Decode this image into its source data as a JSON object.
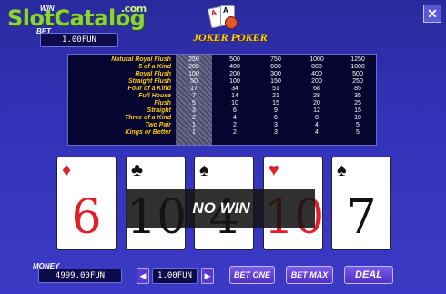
{
  "watermark": {
    "brand": "SlotCatalog",
    "brand_slot": "Slot",
    "brand_catalog": "Catalog",
    "brand_tld": ".com"
  },
  "header": {
    "win_label": "WIN",
    "bet_label": "BET",
    "bet_value": "1.00FUN",
    "logo_line1": "JOKER",
    "logo_line2": "POKER"
  },
  "paytable": {
    "hands": [
      "Natural Royal Flush",
      "5 of a Kind",
      "Royal Flush",
      "Straight Flush",
      "Four of a Kind",
      "Full House",
      "Flush",
      "Straight",
      "Three of a Kind",
      "Two Pair",
      "Kings or Better"
    ],
    "columns": [
      {
        "values": [
          "250",
          "200",
          "100",
          "50",
          "17",
          "7",
          "5",
          "3",
          "2",
          "1",
          "1"
        ],
        "active": true
      },
      {
        "values": [
          "500",
          "400",
          "200",
          "100",
          "34",
          "14",
          "10",
          "6",
          "4",
          "2",
          "2"
        ],
        "active": false
      },
      {
        "values": [
          "750",
          "600",
          "300",
          "150",
          "51",
          "21",
          "15",
          "9",
          "6",
          "3",
          "3"
        ],
        "active": false
      },
      {
        "values": [
          "1000",
          "800",
          "400",
          "200",
          "68",
          "28",
          "20",
          "12",
          "8",
          "4",
          "4"
        ],
        "active": false
      },
      {
        "values": [
          "1250",
          "1000",
          "500",
          "250",
          "85",
          "35",
          "25",
          "15",
          "10",
          "5",
          "5"
        ],
        "active": false
      }
    ]
  },
  "cards": [
    {
      "rank": "6",
      "suit": "♦",
      "color": "red"
    },
    {
      "rank": "10",
      "suit": "♣",
      "color": "black"
    },
    {
      "rank": "4",
      "suit": "♠",
      "color": "black"
    },
    {
      "rank": "10",
      "suit": "♥",
      "color": "red"
    },
    {
      "rank": "7",
      "suit": "♠",
      "color": "black"
    }
  ],
  "result_text": "NO WIN",
  "footer": {
    "money_label": "MONEY",
    "money_value": "4999.00FUN",
    "bet_value": "1.00FUN",
    "decrease_symbol": "◀",
    "increase_symbol": "▶",
    "bet_one_label": "BET ONE",
    "bet_max_label": "BET MAX",
    "deal_label": "DEAL"
  },
  "close_symbol": "✕",
  "colors": {
    "background": "#3232b8",
    "paytable_names": "#ffcc00",
    "logo": "#ffd21a"
  }
}
